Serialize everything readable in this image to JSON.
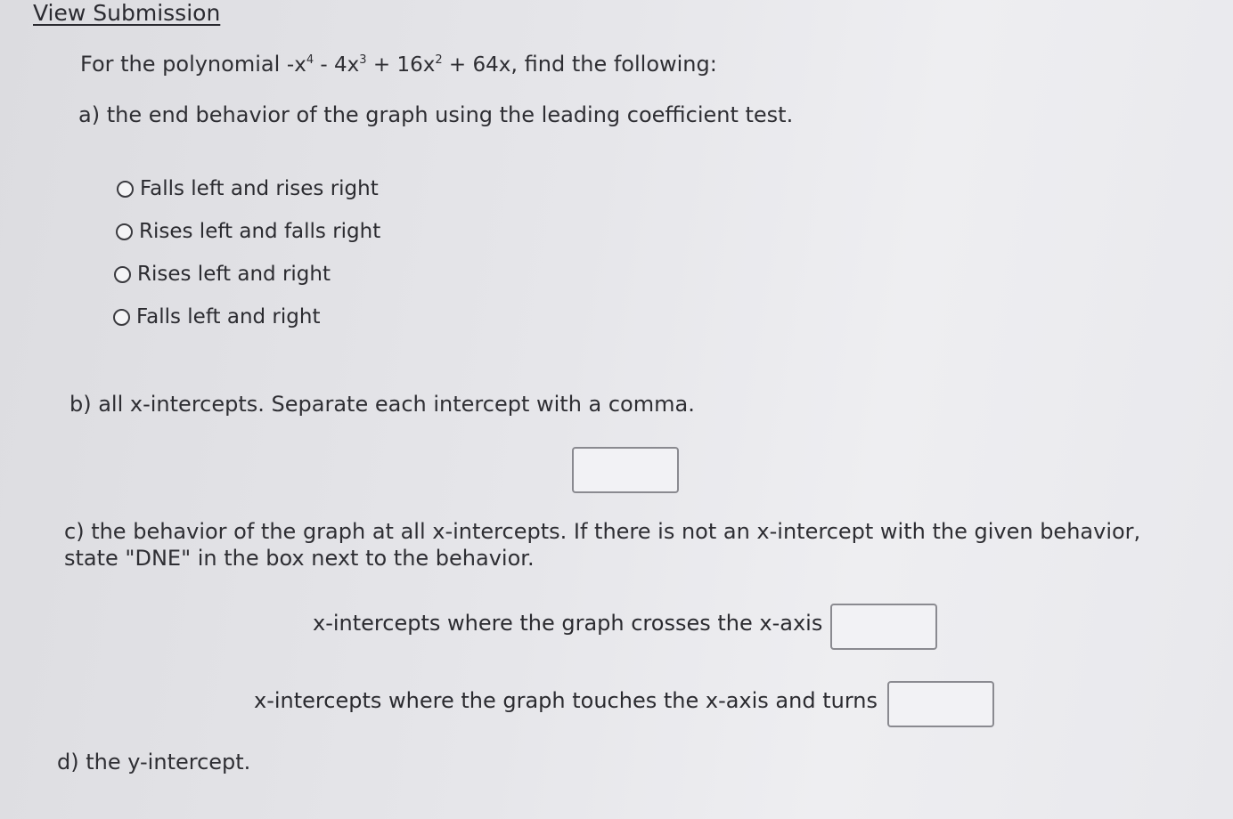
{
  "header": {
    "link_text": "View Submission"
  },
  "problem": {
    "intro_prefix": "For the polynomial ",
    "poly_t1": "-x",
    "poly_e1": "4",
    "poly_t2": " - 4x",
    "poly_e2": "3",
    "poly_t3": " + 16x",
    "poly_e3": "2",
    "poly_t4": " + 64x",
    "intro_suffix": ", find the following:"
  },
  "part_a": {
    "prompt": "a) the end behavior of the graph using the leading coefficient test.",
    "options": [
      "Falls left and rises right",
      "Rises left and falls right",
      "Rises left and right",
      "Falls left and right"
    ]
  },
  "part_b": {
    "prompt": "b) all x-intercepts. Separate each intercept with a comma.",
    "answer": ""
  },
  "part_c": {
    "prompt_line1": "c) the behavior of the graph at all x-intercepts. If there is not an x-intercept with the given behavior,",
    "prompt_line2": "state \"DNE\" in the box next to the behavior.",
    "crosses_label": "x-intercepts where the graph crosses the x-axis",
    "crosses_answer": "",
    "touches_label": "x-intercepts where the graph touches the x-axis and turns",
    "touches_answer": ""
  },
  "part_d": {
    "prompt": "d) the y-intercept."
  }
}
